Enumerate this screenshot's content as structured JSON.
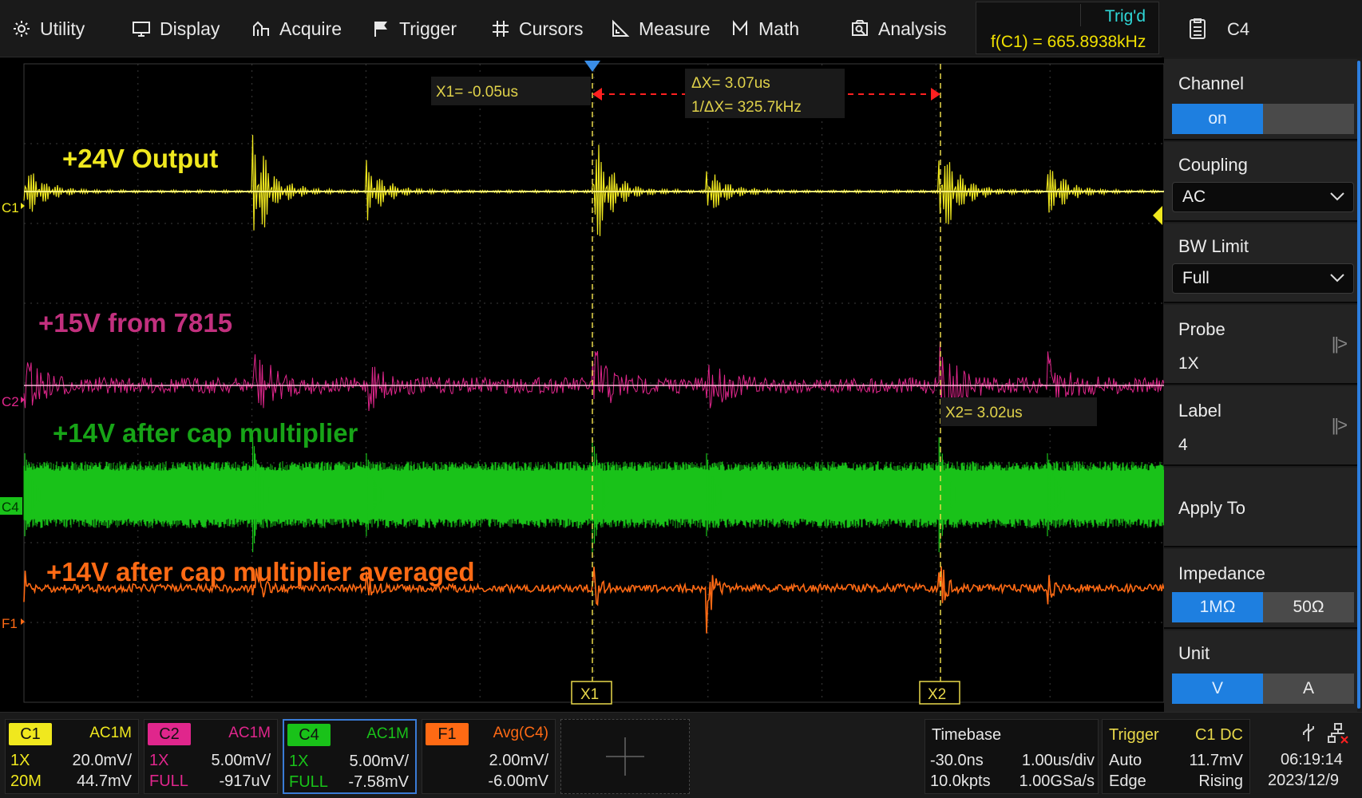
{
  "menu": {
    "items": [
      {
        "label": "Utility",
        "icon": "gear-icon"
      },
      {
        "label": "Display",
        "icon": "monitor-icon"
      },
      {
        "label": "Acquire",
        "icon": "acquire-icon"
      },
      {
        "label": "Trigger",
        "icon": "flag-icon"
      },
      {
        "label": "Cursors",
        "icon": "crosshair-icon"
      },
      {
        "label": "Measure",
        "icon": "measure-icon"
      },
      {
        "label": "Math",
        "icon": "math-icon"
      },
      {
        "label": "Analysis",
        "icon": "analysis-icon"
      }
    ],
    "trig_status": "Trig'd",
    "freq_readout": "f(C1) = 665.8938kHz",
    "channel_menu": "C4"
  },
  "cursors": {
    "x1_readout": "X1= -0.05us",
    "x2_readout": "X2= 3.02us",
    "delta_x": "ΔX= 3.07us",
    "inv_delta_x": "1/ΔX= 325.7kHz",
    "x1_tag": "X1",
    "x2_tag": "X2"
  },
  "traces": {
    "c1": {
      "marker": "C1",
      "label": "+24V Output",
      "color": "#f0e81e"
    },
    "c2": {
      "marker": "C2",
      "label": "+15V from 7815",
      "color": "#e0268c"
    },
    "c4": {
      "marker": "C4",
      "label": "+14V after cap multiplier",
      "color": "#19c219"
    },
    "f1": {
      "marker": "F1",
      "label": "+14V after cap multiplier averaged",
      "color": "#ff6a14"
    }
  },
  "panel": {
    "channel": {
      "title": "Channel",
      "options": [
        "on",
        ""
      ],
      "selected": 0
    },
    "coupling": {
      "title": "Coupling",
      "value": "AC"
    },
    "bw_limit": {
      "title": "BW Limit",
      "value": "Full"
    },
    "probe": {
      "title": "Probe",
      "value": "1X"
    },
    "label": {
      "title": "Label",
      "value": "4"
    },
    "apply_to": {
      "title": "Apply To"
    },
    "impedance": {
      "title": "Impedance",
      "options": [
        "1MΩ",
        "50Ω"
      ],
      "selected": 0
    },
    "unit": {
      "title": "Unit",
      "options": [
        "V",
        "A"
      ],
      "selected": 0
    }
  },
  "status": {
    "c1": {
      "tag": "C1",
      "coupling": "AC1M",
      "probe": "1X",
      "scale": "20.0mV/",
      "bw": "20M",
      "offset": "44.7mV",
      "color": "#f0e81e"
    },
    "c2": {
      "tag": "C2",
      "coupling": "AC1M",
      "probe": "1X",
      "scale": "5.00mV/",
      "bw": "FULL",
      "offset": "-917uV",
      "color": "#e0268c"
    },
    "c4": {
      "tag": "C4",
      "coupling": "AC1M",
      "probe": "1X",
      "scale": "5.00mV/",
      "bw": "FULL",
      "offset": "-7.58mV",
      "color": "#19c219"
    },
    "f1": {
      "tag": "F1",
      "mode": "Avg(C4)",
      "scale": "2.00mV/",
      "offset": "-6.00mV",
      "color": "#ff6a14"
    },
    "timebase": {
      "title": "Timebase",
      "delay": "-30.0ns",
      "scale": "1.00us/div",
      "points": "10.0kpts",
      "rate": "1.00GSa/s"
    },
    "trigger": {
      "title": "Trigger",
      "source": "C1 DC",
      "mode": "Auto",
      "level": "11.7mV",
      "type": "Edge",
      "slope": "Rising"
    },
    "clock": {
      "time": "06:19:14",
      "date": "2023/12/9"
    }
  }
}
